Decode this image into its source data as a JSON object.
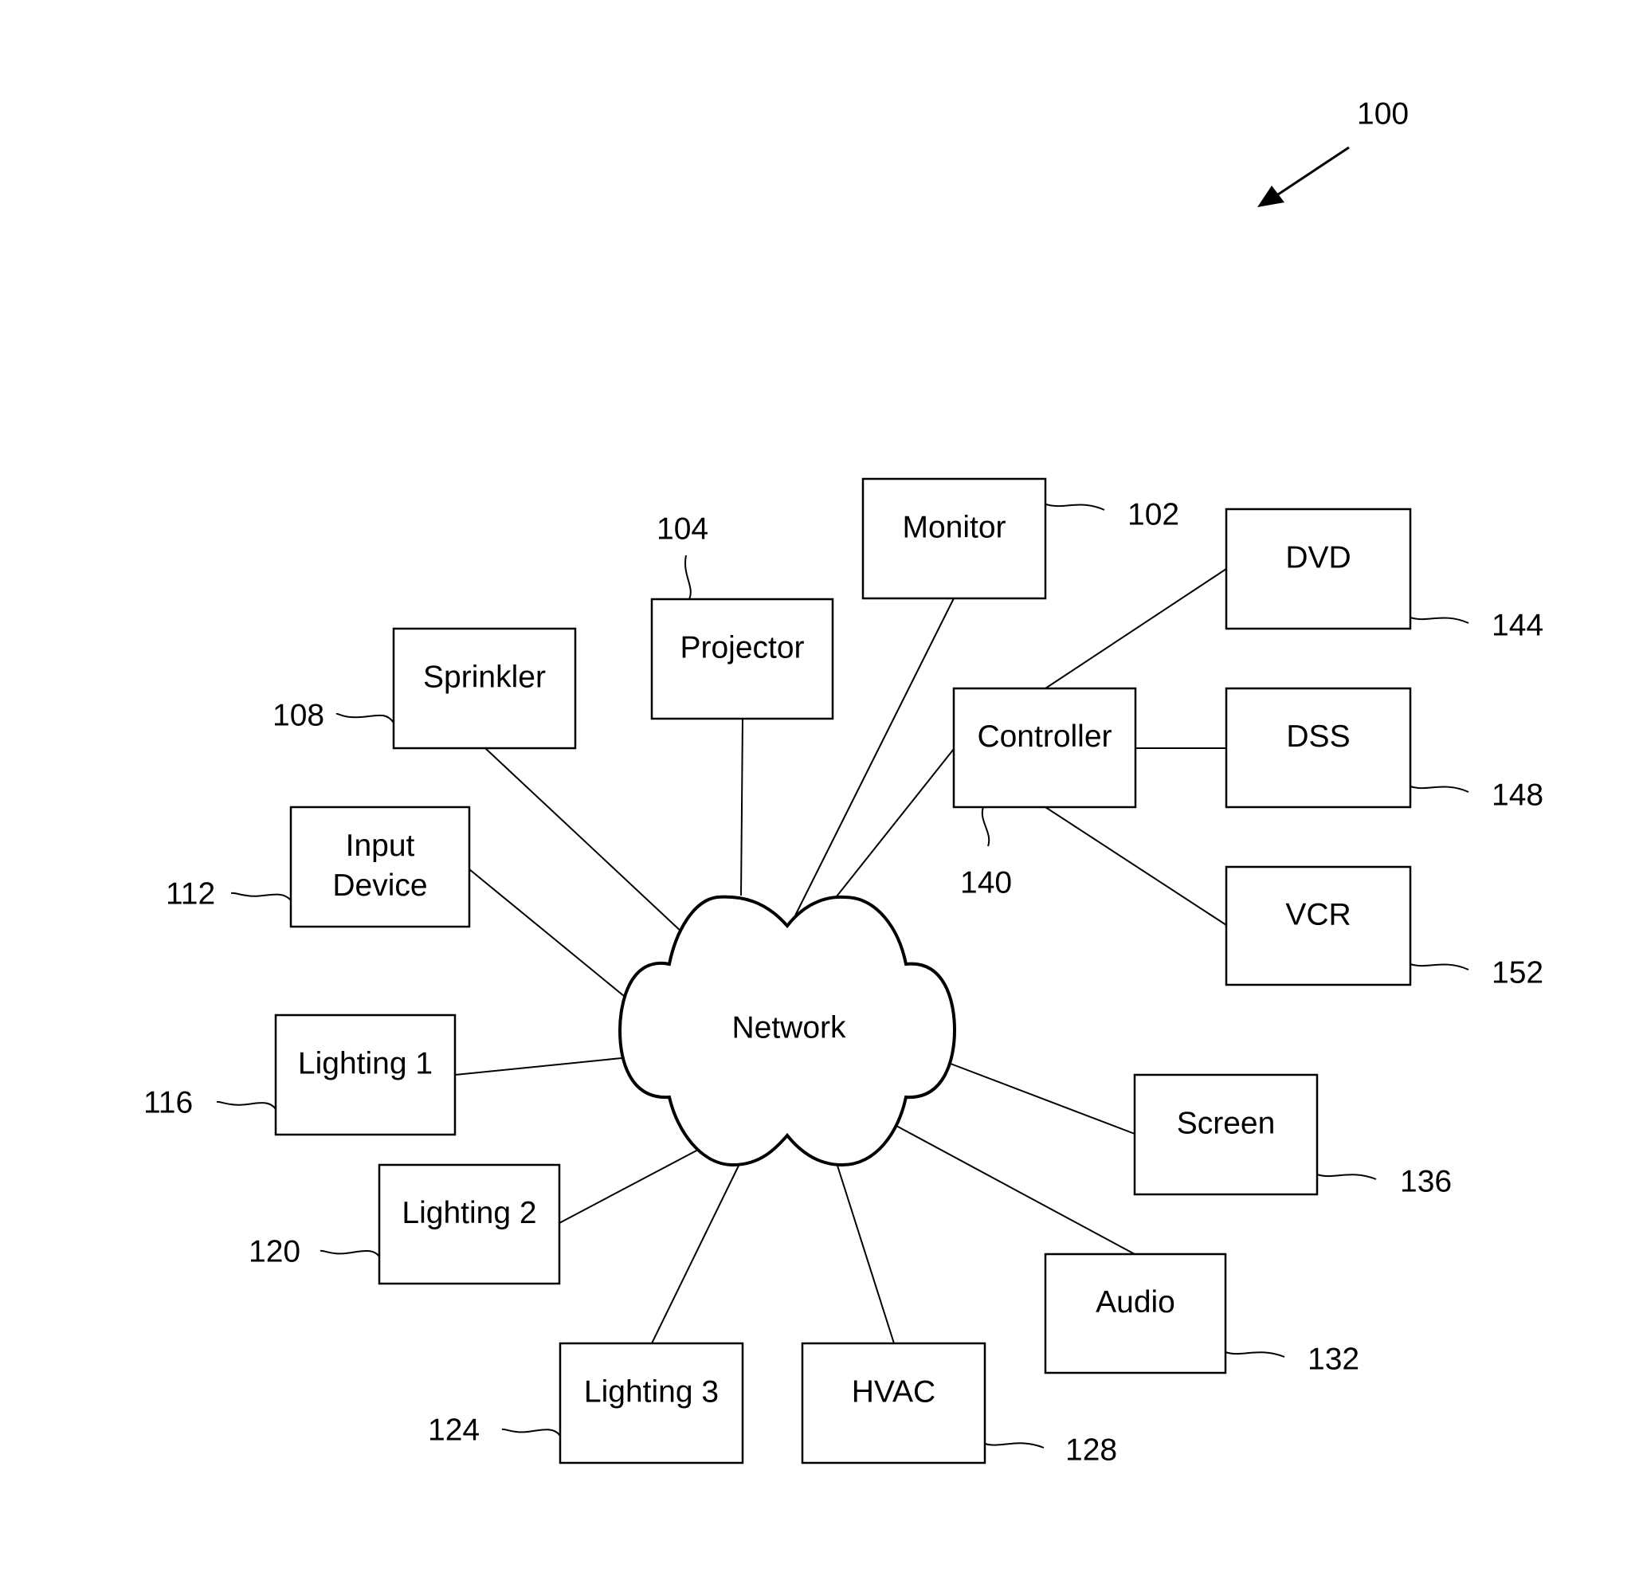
{
  "figure": {
    "reference_number": "100",
    "hub": {
      "id": "network",
      "label": "Network"
    },
    "nodes": [
      {
        "id": "monitor",
        "label": "Monitor",
        "ref": "102"
      },
      {
        "id": "projector",
        "label": "Projector",
        "ref": "104"
      },
      {
        "id": "sprinkler",
        "label": "Sprinkler",
        "ref": "108"
      },
      {
        "id": "input-device",
        "label": "Input Device",
        "ref": "112"
      },
      {
        "id": "lighting-1",
        "label": "Lighting 1",
        "ref": "116"
      },
      {
        "id": "lighting-2",
        "label": "Lighting 2",
        "ref": "120"
      },
      {
        "id": "lighting-3",
        "label": "Lighting 3",
        "ref": "124"
      },
      {
        "id": "hvac",
        "label": "HVAC",
        "ref": "128"
      },
      {
        "id": "audio",
        "label": "Audio",
        "ref": "132"
      },
      {
        "id": "screen",
        "label": "Screen",
        "ref": "136"
      },
      {
        "id": "controller",
        "label": "Controller",
        "ref": "140"
      },
      {
        "id": "dvd",
        "label": "DVD",
        "ref": "144"
      },
      {
        "id": "dss",
        "label": "DSS",
        "ref": "148"
      },
      {
        "id": "vcr",
        "label": "VCR",
        "ref": "152"
      }
    ],
    "edges": [
      [
        "network",
        "monitor"
      ],
      [
        "network",
        "projector"
      ],
      [
        "network",
        "sprinkler"
      ],
      [
        "network",
        "input-device"
      ],
      [
        "network",
        "lighting-1"
      ],
      [
        "network",
        "lighting-2"
      ],
      [
        "network",
        "lighting-3"
      ],
      [
        "network",
        "hvac"
      ],
      [
        "network",
        "audio"
      ],
      [
        "network",
        "screen"
      ],
      [
        "network",
        "controller"
      ],
      [
        "controller",
        "dvd"
      ],
      [
        "controller",
        "dss"
      ],
      [
        "controller",
        "vcr"
      ]
    ]
  }
}
